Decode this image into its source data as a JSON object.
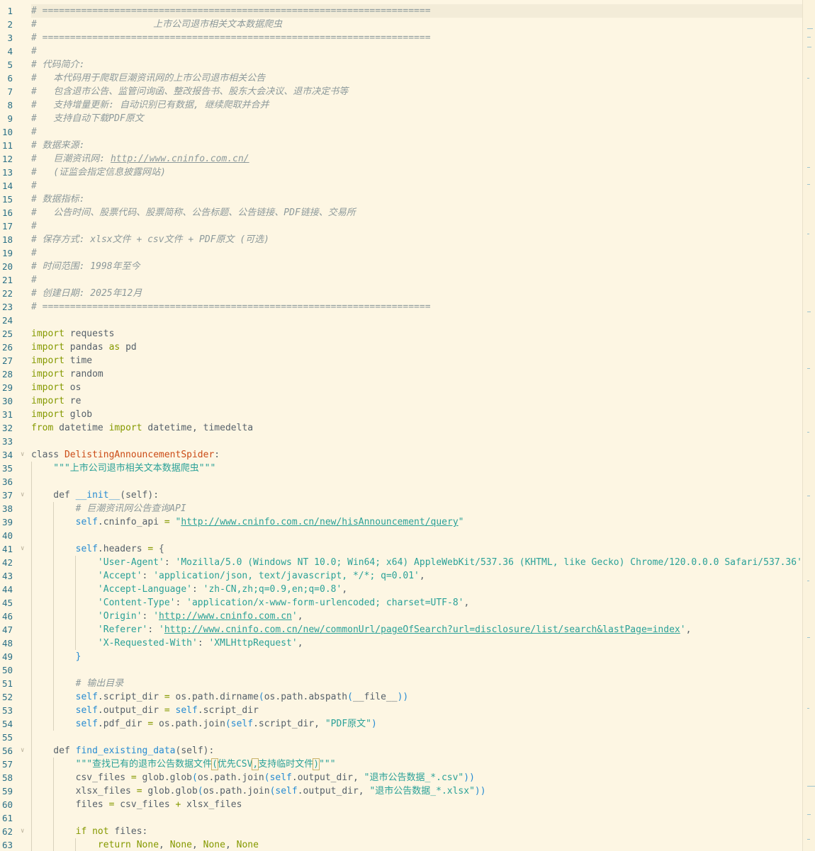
{
  "editor": {
    "lines": [
      [
        [
          "comment",
          "# ======================================================================"
        ]
      ],
      [
        [
          "comment",
          "#                     上市公司退市相关文本数据爬虫"
        ]
      ],
      [
        [
          "comment",
          "# ======================================================================"
        ]
      ],
      [
        [
          "comment",
          "#"
        ]
      ],
      [
        [
          "comment",
          "# 代码简介:"
        ]
      ],
      [
        [
          "comment",
          "#   本代码用于爬取巨潮资讯网的上市公司退市相关公告"
        ]
      ],
      [
        [
          "comment",
          "#   包含退市公告、监管问询函、整改报告书、股东大会决议、退市决定书等"
        ]
      ],
      [
        [
          "comment",
          "#   支持增量更新: 自动识别已有数据, 继续爬取并合并"
        ]
      ],
      [
        [
          "comment",
          "#   支持自动下载PDF原文"
        ]
      ],
      [
        [
          "comment",
          "#"
        ]
      ],
      [
        [
          "comment",
          "# 数据来源:"
        ]
      ],
      [
        [
          "comment",
          "#   巨潮资讯网: "
        ],
        [
          "comment lnk",
          "http://www.cninfo.com.cn/"
        ]
      ],
      [
        [
          "comment",
          "#   (证监会指定信息披露网站)"
        ]
      ],
      [
        [
          "comment",
          "#"
        ]
      ],
      [
        [
          "comment",
          "# 数据指标:"
        ]
      ],
      [
        [
          "comment",
          "#   公告时间、股票代码、股票简称、公告标题、公告链接、PDF链接、交易所"
        ]
      ],
      [
        [
          "comment",
          "#"
        ]
      ],
      [
        [
          "comment",
          "# 保存方式: xlsx文件 + csv文件 + PDF原文 (可选)"
        ]
      ],
      [
        [
          "comment",
          "#"
        ]
      ],
      [
        [
          "comment",
          "# 时间范围: 1998年至今"
        ]
      ],
      [
        [
          "comment",
          "#"
        ]
      ],
      [
        [
          "comment",
          "# 创建日期: 2025年12月"
        ]
      ],
      [
        [
          "comment",
          "# ======================================================================"
        ]
      ],
      [],
      [
        [
          "kw",
          "import"
        ],
        [
          "sp",
          " requests"
        ]
      ],
      [
        [
          "kw",
          "import"
        ],
        [
          "sp",
          " pandas "
        ],
        [
          "kw",
          "as"
        ],
        [
          "sp",
          " pd"
        ]
      ],
      [
        [
          "kw",
          "import"
        ],
        [
          "sp",
          " time"
        ]
      ],
      [
        [
          "kw",
          "import"
        ],
        [
          "sp",
          " random"
        ]
      ],
      [
        [
          "kw",
          "import"
        ],
        [
          "sp",
          " os"
        ]
      ],
      [
        [
          "kw",
          "import"
        ],
        [
          "sp",
          " re"
        ]
      ],
      [
        [
          "kw",
          "import"
        ],
        [
          "sp",
          " glob"
        ]
      ],
      [
        [
          "kw",
          "from"
        ],
        [
          "sp",
          " datetime "
        ],
        [
          "kw",
          "import"
        ],
        [
          "sp",
          " datetime, timedelta"
        ]
      ],
      [],
      [
        [
          "sp",
          "class "
        ],
        [
          "cls",
          "DelistingAnnouncementSpider"
        ],
        [
          "sp",
          ":"
        ]
      ],
      [
        [
          "str",
          "    \"\"\"上市公司退市相关文本数据爬虫\"\"\""
        ]
      ],
      [],
      [
        [
          "sp",
          "    def "
        ],
        [
          "fn",
          "__init__"
        ],
        [
          "sp",
          "(self):"
        ]
      ],
      [
        [
          "comment",
          "        # 巨潮资讯网公告查询API"
        ]
      ],
      [
        [
          "self",
          "        self"
        ],
        [
          "sp",
          ".cninfo_api "
        ],
        [
          "op",
          "="
        ],
        [
          "sp",
          " "
        ],
        [
          "str",
          "\""
        ],
        [
          "str lnk",
          "http://www.cninfo.com.cn/new/hisAnnouncement/query"
        ],
        [
          "str",
          "\""
        ]
      ],
      [],
      [
        [
          "self",
          "        self"
        ],
        [
          "sp",
          ".headers "
        ],
        [
          "op",
          "="
        ],
        [
          "sp",
          " {"
        ]
      ],
      [
        [
          "str",
          "            'User-Agent'"
        ],
        [
          "sp",
          ": "
        ],
        [
          "str",
          "'Mozilla/5.0 (Windows NT 10.0; Win64; x64) AppleWebKit/537.36 (KHTML, like Gecko) Chrome/120.0.0.0 Safari/537.36'"
        ],
        [
          "sp",
          ","
        ]
      ],
      [
        [
          "str",
          "            'Accept'"
        ],
        [
          "sp",
          ": "
        ],
        [
          "str",
          "'application/json, text/javascript, */*; q=0.01'"
        ],
        [
          "sp",
          ","
        ]
      ],
      [
        [
          "str",
          "            'Accept-Language'"
        ],
        [
          "sp",
          ": "
        ],
        [
          "str",
          "'zh-CN,zh;q=0.9,en;q=0.8'"
        ],
        [
          "sp",
          ","
        ]
      ],
      [
        [
          "str",
          "            'Content-Type'"
        ],
        [
          "sp",
          ": "
        ],
        [
          "str",
          "'application/x-www-form-urlencoded; charset=UTF-8'"
        ],
        [
          "sp",
          ","
        ]
      ],
      [
        [
          "str",
          "            'Origin'"
        ],
        [
          "sp",
          ": "
        ],
        [
          "str",
          "'"
        ],
        [
          "str lnk",
          "http://www.cninfo.com.cn"
        ],
        [
          "str",
          "'"
        ],
        [
          "sp",
          ","
        ]
      ],
      [
        [
          "str",
          "            'Referer'"
        ],
        [
          "sp",
          ": "
        ],
        [
          "str",
          "'"
        ],
        [
          "str lnk",
          "http://www.cninfo.com.cn/new/commonUrl/pageOfSearch?url=disclosure/list/search&lastPage=index"
        ],
        [
          "str",
          "'"
        ],
        [
          "sp",
          ","
        ]
      ],
      [
        [
          "str",
          "            'X-Requested-With'"
        ],
        [
          "sp",
          ": "
        ],
        [
          "str",
          "'XMLHttpRequest'"
        ],
        [
          "sp",
          ","
        ]
      ],
      [
        [
          "br1",
          "        }"
        ]
      ],
      [],
      [
        [
          "comment",
          "        # 输出目录"
        ]
      ],
      [
        [
          "self",
          "        self"
        ],
        [
          "sp",
          ".script_dir "
        ],
        [
          "op",
          "="
        ],
        [
          "sp",
          " os.path.dirname"
        ],
        [
          "br1",
          "("
        ],
        [
          "sp",
          "os.path.abspath"
        ],
        [
          "br1",
          "("
        ],
        [
          "sp",
          "__file__"
        ],
        [
          "br1",
          "))"
        ]
      ],
      [
        [
          "self",
          "        self"
        ],
        [
          "sp",
          ".output_dir "
        ],
        [
          "op",
          "="
        ],
        [
          "sp",
          " "
        ],
        [
          "self",
          "self"
        ],
        [
          "sp",
          ".script_dir"
        ]
      ],
      [
        [
          "self",
          "        self"
        ],
        [
          "sp",
          ".pdf_dir "
        ],
        [
          "op",
          "="
        ],
        [
          "sp",
          " os.path.join"
        ],
        [
          "br1",
          "("
        ],
        [
          "self",
          "self"
        ],
        [
          "sp",
          ".script_dir, "
        ],
        [
          "str",
          "\"PDF原文\""
        ],
        [
          "br1",
          ")"
        ]
      ],
      [],
      [
        [
          "sp",
          "    def "
        ],
        [
          "fn",
          "find_existing_data"
        ],
        [
          "sp",
          "(self):"
        ]
      ],
      [
        [
          "str",
          "        \"\"\"查找已有的退市公告数据文件"
        ],
        [
          "str brhl",
          "("
        ],
        [
          "str",
          "优先CSV"
        ],
        [
          "str brhl",
          ","
        ],
        [
          "str",
          "支持临时文件"
        ],
        [
          "str brhl",
          ")"
        ],
        [
          "str",
          "\"\"\""
        ]
      ],
      [
        [
          "sp",
          "        csv_files "
        ],
        [
          "op",
          "="
        ],
        [
          "sp",
          " glob.glob"
        ],
        [
          "br1",
          "("
        ],
        [
          "sp",
          "os.path.join"
        ],
        [
          "br1",
          "("
        ],
        [
          "self",
          "self"
        ],
        [
          "sp",
          ".output_dir, "
        ],
        [
          "str",
          "\"退市公告数据_*.csv\""
        ],
        [
          "br1",
          "))"
        ]
      ],
      [
        [
          "sp",
          "        xlsx_files "
        ],
        [
          "op",
          "="
        ],
        [
          "sp",
          " glob.glob"
        ],
        [
          "br1",
          "("
        ],
        [
          "sp",
          "os.path.join"
        ],
        [
          "br1",
          "("
        ],
        [
          "self",
          "self"
        ],
        [
          "sp",
          ".output_dir, "
        ],
        [
          "str",
          "\"退市公告数据_*.xlsx\""
        ],
        [
          "br1",
          "))"
        ]
      ],
      [
        [
          "sp",
          "        files "
        ],
        [
          "op",
          "="
        ],
        [
          "sp",
          " csv_files "
        ],
        [
          "op",
          "+"
        ],
        [
          "sp",
          " xlsx_files"
        ]
      ],
      [],
      [
        [
          "kw",
          "        if not"
        ],
        [
          "sp",
          " files:"
        ]
      ],
      [
        [
          "kw",
          "            return"
        ],
        [
          "sp",
          " "
        ],
        [
          "kw",
          "None"
        ],
        [
          "sp",
          ", "
        ],
        [
          "kw",
          "None"
        ],
        [
          "sp",
          ", "
        ],
        [
          "kw",
          "None"
        ],
        [
          "sp",
          ", "
        ],
        [
          "kw",
          "None"
        ]
      ]
    ],
    "fold_markers": [
      34,
      37,
      41,
      56,
      62
    ],
    "current_line": 1
  },
  "colors": {
    "background": "#fdf6e3",
    "line_number": "#2a6f86",
    "comment": "#8d9a9c",
    "keyword": "#859900",
    "string": "#2aa198",
    "class_name": "#cb4b16",
    "function": "#268bd2"
  }
}
